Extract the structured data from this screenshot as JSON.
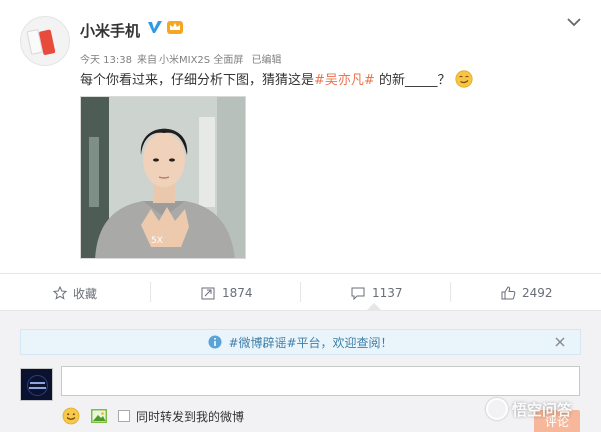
{
  "post": {
    "username": "小米手机",
    "timestamp": "今天 13:38",
    "source_prefix": "来自",
    "source_device": "小米MIX2S 全面屏",
    "edited": "已编辑",
    "text_before": "每个你看过来，仔细分析下图，猜猜这是",
    "hashtag": "#吴亦凡#",
    "text_after": " 的新_____？",
    "image_caption": "image"
  },
  "actions": {
    "favorite_label": "收藏",
    "repost_count": "1874",
    "comment_count": "1137",
    "like_count": "2492"
  },
  "comment": {
    "notice": "#微博辟谣#平台，欢迎查阅！",
    "input_value": "",
    "repost_label": "同时转发到我的微博",
    "submit_label": "评论"
  },
  "watermark": {
    "text": "悟空问答"
  },
  "colors": {
    "hashtag": "#eb7350",
    "notice_text": "#3f7fa8",
    "badge_blue": "#2f9ae4",
    "badge_orange": "#f5a623"
  }
}
